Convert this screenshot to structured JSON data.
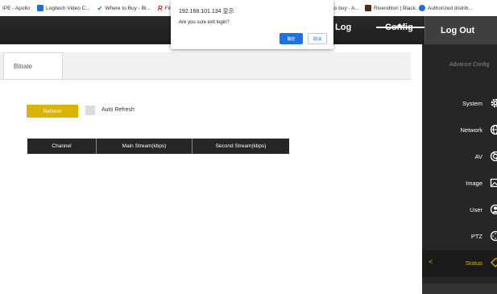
{
  "bookmarks": [
    {
      "label": "IPE - Apollo",
      "color": ""
    },
    {
      "label": "Logitech Video C...",
      "color": "#1e6fd9"
    },
    {
      "label": "Where to Buy - Bi...",
      "color": "#2f8f2f"
    },
    {
      "label": "Find a Bi",
      "color": "#d8252c"
    },
    {
      "label": "to buy - A...",
      "color": ""
    },
    {
      "label": "Rivenditori | Black...",
      "color": "#4a2e1a"
    },
    {
      "label": "Authorized distrib...",
      "color": "#1e6fd9"
    }
  ],
  "header": {
    "nav": {
      "log": "Log",
      "config": "Config"
    },
    "logout": "Log Out"
  },
  "content": {
    "tab": "Bitrate",
    "refresh_label": "Refresh",
    "auto_refresh_label": "Auto Refresh",
    "table": {
      "columns": [
        "Channel",
        "Main Stream(kbps)",
        "Second Stream(kbps)"
      ],
      "rows": []
    }
  },
  "sidebar": {
    "title": "Advance Config",
    "items": [
      {
        "label": "System",
        "icon": "gear-icon",
        "active": false
      },
      {
        "label": "Network",
        "icon": "globe-icon",
        "active": false
      },
      {
        "label": "AV",
        "icon": "camera-lens-icon",
        "active": false
      },
      {
        "label": "Image",
        "icon": "picture-icon",
        "active": false
      },
      {
        "label": "User",
        "icon": "user-icon",
        "active": false
      },
      {
        "label": "PTZ",
        "icon": "ptz-icon",
        "active": false
      },
      {
        "label": "Status",
        "icon": "tag-icon",
        "active": true
      }
    ]
  },
  "dialog": {
    "title": "192.168.101.134 显示",
    "message": "Are you sure exit login?",
    "ok_label": "确定",
    "cancel_label": "取消"
  },
  "colors": {
    "accent": "#ddb300",
    "header_bg": "#1d1d1d",
    "sidebar_bg": "#262626",
    "dialog_button": "#1a73e8"
  }
}
